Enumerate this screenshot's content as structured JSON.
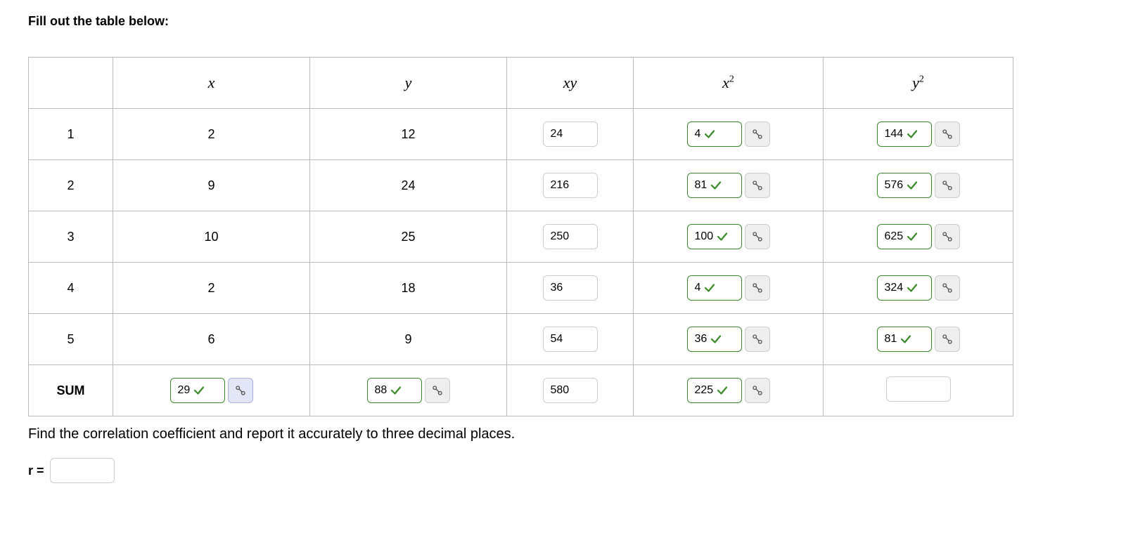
{
  "prompt": "Fill out the table below:",
  "headers": {
    "x": "x",
    "y": "y",
    "xy": "xy",
    "x2_base": "x",
    "x2_exp": "2",
    "y2_base": "y",
    "y2_exp": "2"
  },
  "rows": [
    {
      "idx": "1",
      "x": "2",
      "y": "12",
      "xy": "24",
      "x2": "4",
      "y2": "144"
    },
    {
      "idx": "2",
      "x": "9",
      "y": "24",
      "xy": "216",
      "x2": "81",
      "y2": "576"
    },
    {
      "idx": "3",
      "x": "10",
      "y": "25",
      "xy": "250",
      "x2": "100",
      "y2": "625"
    },
    {
      "idx": "4",
      "x": "2",
      "y": "18",
      "xy": "36",
      "x2": "4",
      "y2": "324"
    },
    {
      "idx": "5",
      "x": "6",
      "y": "9",
      "xy": "54",
      "x2": "36",
      "y2": "81"
    }
  ],
  "sum": {
    "label": "SUM",
    "x": "29",
    "y": "88",
    "xy": "580",
    "x2": "225",
    "y2": ""
  },
  "instruction2": "Find the correlation coefficient and report it accurately to three decimal places.",
  "r_label": "r =",
  "r_value": "",
  "colors": {
    "correct": "#3a8a2a",
    "check": "#3a8a2a"
  }
}
